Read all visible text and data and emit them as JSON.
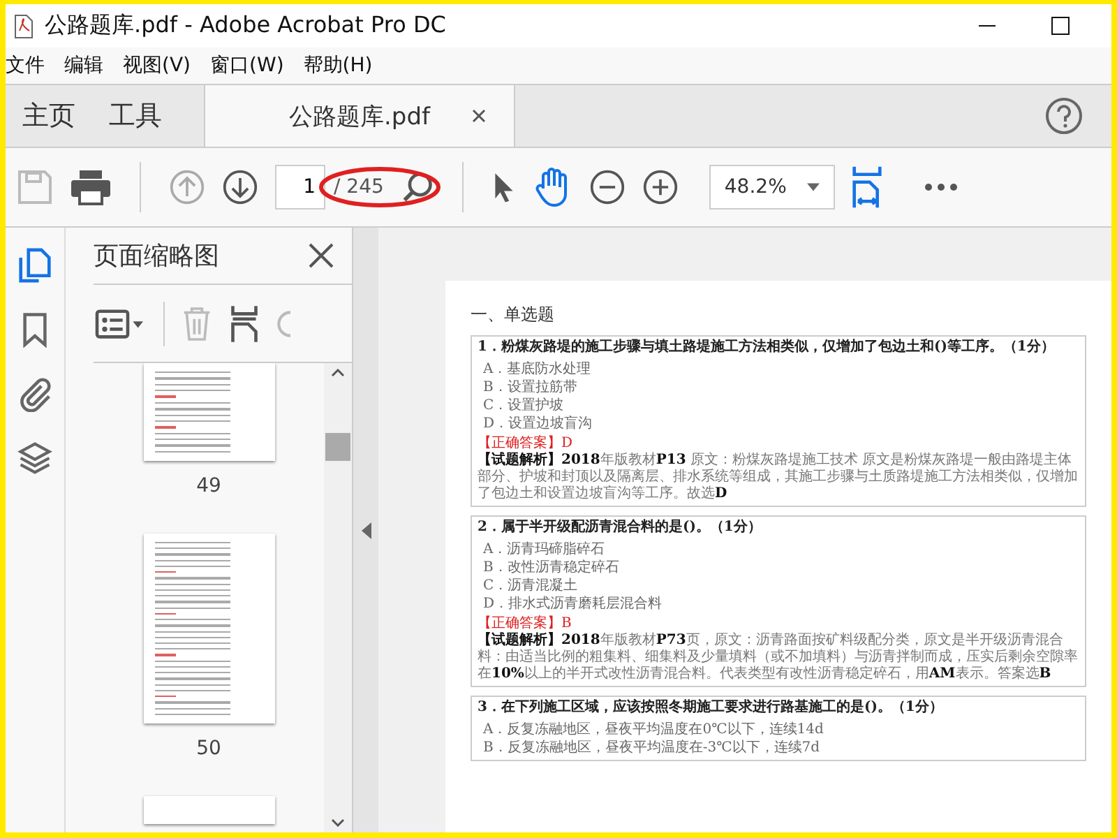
{
  "window": {
    "title": "公路题库.pdf - Adobe Acrobat Pro DC"
  },
  "menu": [
    "文件",
    "编辑",
    "视图(V)",
    "窗口(W)",
    "帮助(H)"
  ],
  "tabs": [
    {
      "label": "主页",
      "selected": false,
      "closable": false
    },
    {
      "label": "工具",
      "selected": false,
      "closable": false
    },
    {
      "label": "公路题库.pdf",
      "selected": true,
      "closable": true
    }
  ],
  "toolbar": {
    "page_number": "1",
    "page_count": "/ 245",
    "zoom": "48.2%"
  },
  "sidebar": {
    "title": "页面缩略图",
    "thumbnails": [
      {
        "page": "49"
      },
      {
        "page": "50"
      }
    ]
  },
  "document": {
    "section": "一、单选题",
    "questions": [
      {
        "stem": "1．粉煤灰路堤的施工步骤与填土路堤施工方法相类似，仅增加了包边土和()等工序。（1分）",
        "options": [
          "A．基底防水处理",
          "B．设置拉筋带",
          "C．设置护坡",
          "D．设置边坡盲沟"
        ],
        "answer": "【正确答案】D",
        "analysis": "**【试题解析】2018**年版教材**P13** 原文：粉煤灰路堤施工技术 原文是粉煤灰路堤一般由路堤主体部分、护坡和封顶以及隔离层、排水系统等组成，其施工步骤与土质路堤施工方法相类似，仅增加了包边土和设置边坡盲沟等工序。故选**D**"
      },
      {
        "stem": "2．属于半开级配沥青混合料的是()。（1分）",
        "options": [
          "A．沥青玛碲脂碎石",
          "B．改性沥青稳定碎石",
          "C．沥青混凝土",
          "D．排水式沥青磨耗层混合料"
        ],
        "answer": "【正确答案】B",
        "analysis": "**【试题解析】2018**年版教材**P73**页，原文：沥青路面按矿料级配分类，原文是半开级沥青混合料：由适当比例的粗集料、细集料及少量填料（或不加填料）与沥青拌制而成，压实后剩余空隙率在**10%**以上的半开式改性沥青混合料。代表类型有改性沥青稳定碎石，用**AM**表示。答案选**B**"
      },
      {
        "stem": "3．在下列施工区域，应该按照冬期施工要求进行路基施工的是()。（1分）",
        "options": [
          "A．反复冻融地区，昼夜平均温度在0℃以下，连续14d",
          "B．反复冻融地区，昼夜平均温度在-3℃以下，连续7d"
        ]
      }
    ]
  }
}
